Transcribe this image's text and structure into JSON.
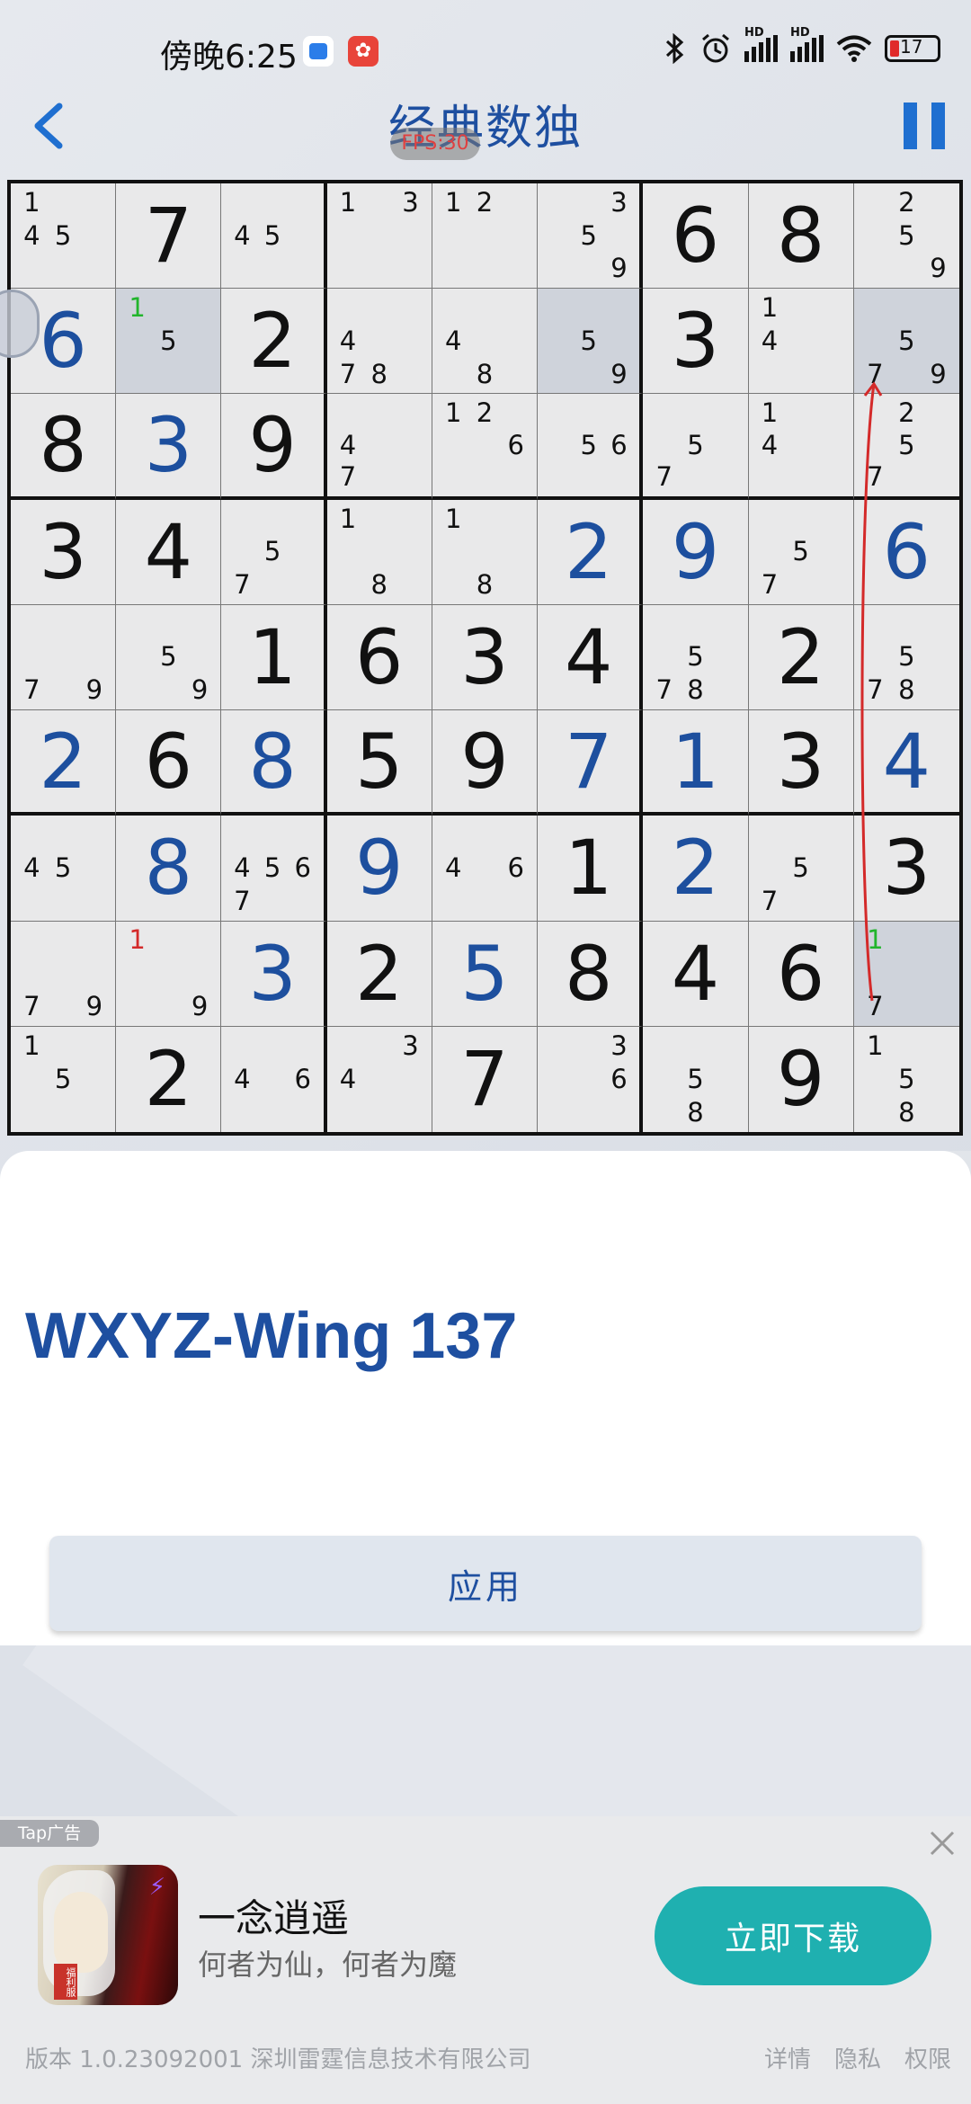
{
  "status_bar": {
    "time": "傍晚6:25",
    "battery": "17",
    "hd1": "HD",
    "hd2": "HD",
    "app2_glyph": "✿"
  },
  "header": {
    "title": "经典数独",
    "fps": "FPS:30"
  },
  "colors": {
    "accent": "#1e4fa0",
    "user_digit": "#1d4f9e",
    "highlight": "#cfd3db",
    "ad_button": "#1fb0b0"
  },
  "board": [
    [
      "n:1,4,5",
      "g:7",
      "n:4,5",
      "n:1,3",
      "n:1,2",
      "n:3,5,9",
      "g:6",
      "g:8",
      "n:2,5,9"
    ],
    [
      "u:6",
      "h:n:1g,5",
      "g:2",
      "n:4,7,8",
      "n:4,8",
      "h:n:5,9",
      "g:3",
      "n:1,4",
      "h:n:5,7,9"
    ],
    [
      "g:8",
      "u:3",
      "g:9",
      "n:4,7",
      "n:1,2,6",
      "n:5,6",
      "n:5,7",
      "n:1,4",
      "n:2,5,7"
    ],
    [
      "g:3",
      "g:4",
      "n:5,7",
      "n:1,8",
      "n:1,8",
      "u:2",
      "u:9",
      "n:5,7",
      "u:6"
    ],
    [
      "n:7,9",
      "n:5,9",
      "g:1",
      "g:6",
      "g:3",
      "g:4",
      "n:5,7,8",
      "g:2",
      "n:5,7,8"
    ],
    [
      "u:2",
      "g:6",
      "u:8",
      "g:5",
      "g:9",
      "u:7",
      "u:1",
      "g:3",
      "u:4"
    ],
    [
      "n:4,5",
      "u:8",
      "n:4,5,6,7",
      "u:9",
      "n:4,6",
      "g:1",
      "u:2",
      "n:5,7",
      "g:3"
    ],
    [
      "n:7,9",
      "n:1r,9",
      "u:3",
      "g:2",
      "u:5",
      "g:8",
      "g:4",
      "g:6",
      "h:n:1g,7"
    ],
    [
      "n:1,5",
      "g:2",
      "n:4,6",
      "n:3,4",
      "g:7",
      "n:3,6",
      "n:5,8",
      "g:9",
      "n:1,5,8"
    ]
  ],
  "hint": {
    "title": "WXYZ-Wing 137",
    "apply_label": "应用"
  },
  "ad": {
    "tag": "Tap广告",
    "badge": "福利服",
    "name": "一念逍遥",
    "desc": "何者为仙，何者为魔",
    "button": "立即下载",
    "footer": "版本 1.0.23092001   深圳雷霆信息技术有限公司",
    "links": [
      "详情",
      "隐私",
      "权限"
    ]
  }
}
